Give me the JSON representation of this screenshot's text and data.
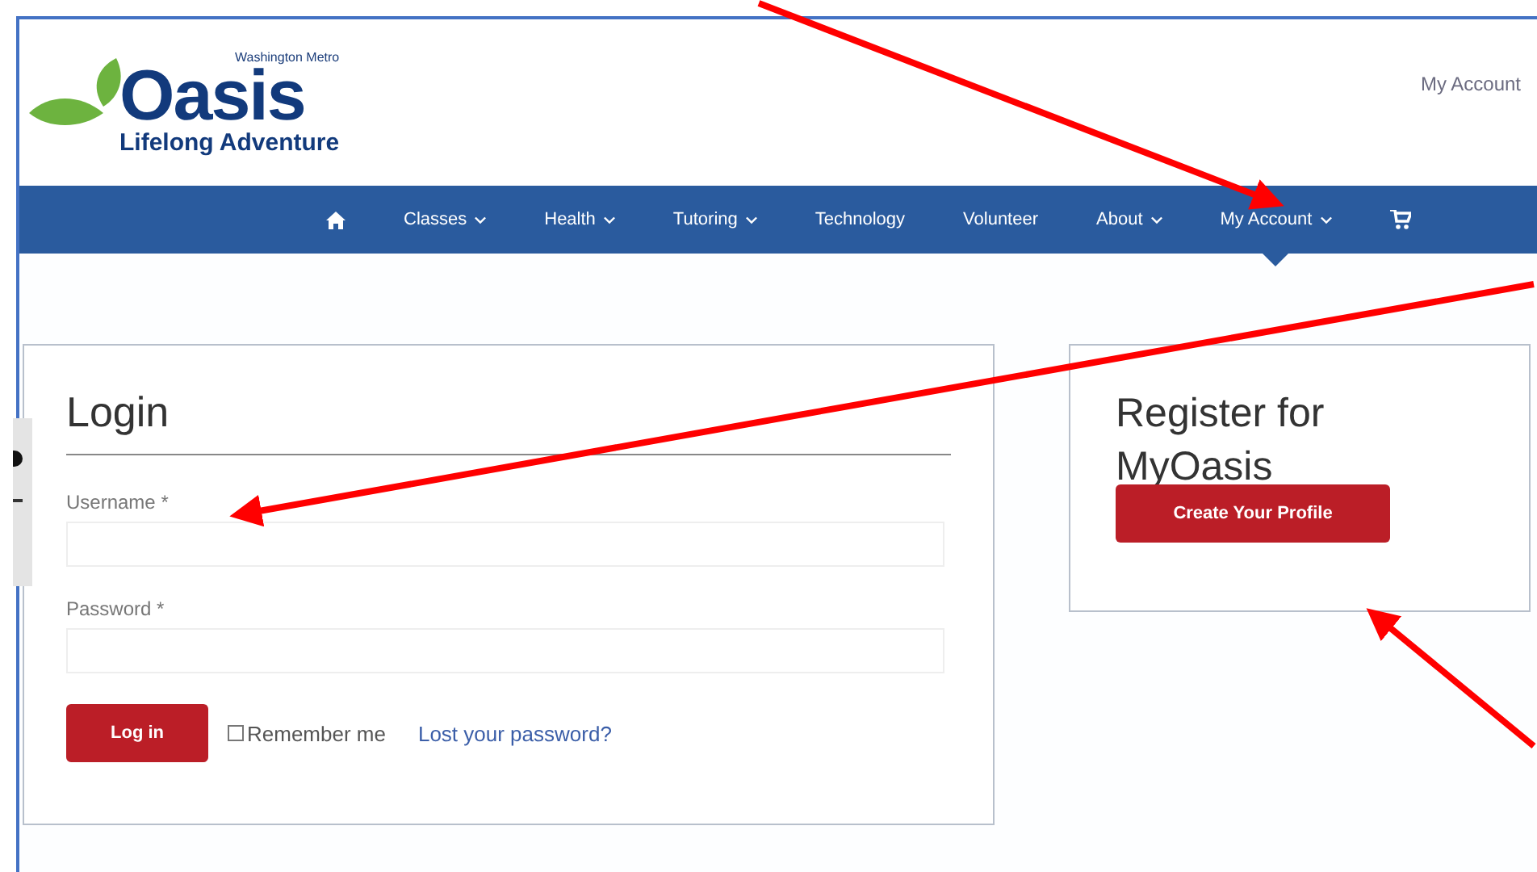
{
  "logo": {
    "tagline_top": "Washington Metro",
    "name": "Oasis",
    "tagline_bottom": "Lifelong Adventure"
  },
  "header_link": "My Account",
  "nav": [
    {
      "kind": "home",
      "selected": false
    },
    {
      "kind": "link",
      "label": "Classes",
      "dropdown": true,
      "selected": false
    },
    {
      "kind": "link",
      "label": "Health",
      "dropdown": true,
      "selected": false
    },
    {
      "kind": "link",
      "label": "Tutoring",
      "dropdown": true,
      "selected": false
    },
    {
      "kind": "link",
      "label": "Technology",
      "dropdown": false,
      "selected": false
    },
    {
      "kind": "link",
      "label": "Volunteer",
      "dropdown": false,
      "selected": false
    },
    {
      "kind": "link",
      "label": "About",
      "dropdown": true,
      "selected": false
    },
    {
      "kind": "link",
      "label": "My Account",
      "dropdown": true,
      "selected": true
    },
    {
      "kind": "cart",
      "selected": false
    }
  ],
  "login": {
    "title": "Login",
    "fields": [
      {
        "label": "Username *"
      },
      {
        "label": "Password *"
      }
    ],
    "button": "Log in",
    "remember": {
      "label": "Remember me",
      "checked": false
    },
    "lost_link": "Lost your password?"
  },
  "register": {
    "title": "Register for MyOasis",
    "button": "Create Your Profile"
  }
}
